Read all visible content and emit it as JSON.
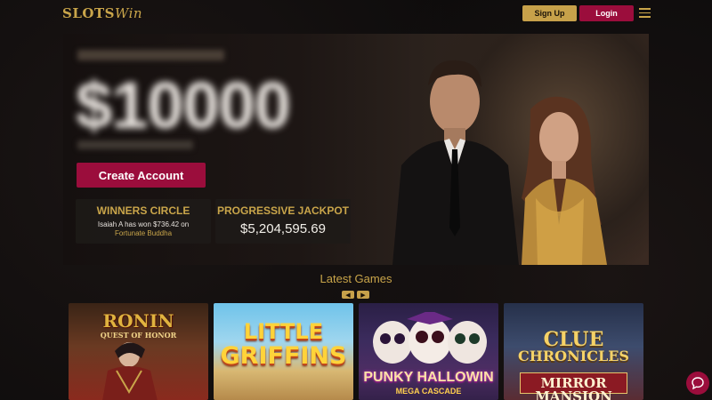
{
  "header": {
    "logo_main": "SLOTS",
    "logo_accent": "Win",
    "signup_label": "Sign Up",
    "login_label": "Login"
  },
  "hero": {
    "amount": "$10000",
    "create_account_label": "Create Account",
    "winners": {
      "title": "WINNERS CIRCLE",
      "text": "Isaiah A has won $736.42 on",
      "game": "Fortunate Buddha"
    },
    "jackpot": {
      "title": "PROGRESSIVE JACKPOT",
      "value": "$5,204,595.69"
    }
  },
  "latest_games": {
    "title": "Latest Games",
    "prev_icon": "chevron-left-icon",
    "next_icon": "chevron-right-icon",
    "tiles": [
      {
        "title": "RONIN",
        "subtitle": "QUEST OF HONOR"
      },
      {
        "title": "LITTLE",
        "subtitle": "GRIFFINS"
      },
      {
        "title": "PUNKY HALLOWIN",
        "subtitle": "MEGA CASCADE"
      },
      {
        "title": "CLUE",
        "subtitle": "CHRONICLES",
        "extra": "MIRROR MANSION"
      }
    ]
  },
  "colors": {
    "gold": "#c9a54a",
    "crimson": "#9b0d3c",
    "background": "#0e0c0c"
  },
  "chat_icon": "chat-bubble-icon"
}
